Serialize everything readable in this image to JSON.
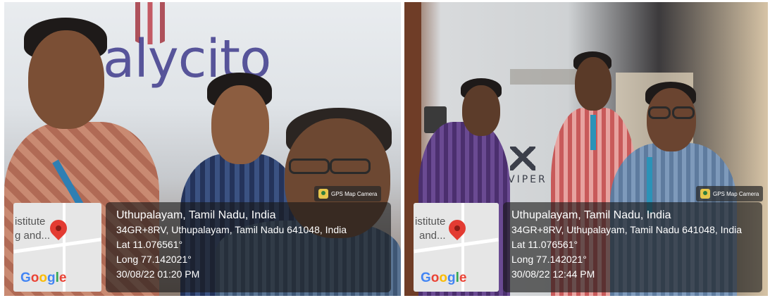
{
  "photos": [
    {
      "id": "left",
      "logo_text": "alycito",
      "badge": "GPS Map Camera",
      "map_text_1": "istitute",
      "map_text_2": "g and...",
      "google": [
        "G",
        "o",
        "o",
        "g",
        "l",
        "e"
      ],
      "location_title": "Uthupalayam, Tamil Nadu, India",
      "address": "34GR+8RV, Uthupalayam, Tamil Nadu 641048, India",
      "lat": "Lat 11.076561°",
      "long": "Long 77.142021°",
      "datetime": "30/08/22 01:20 PM"
    },
    {
      "id": "right",
      "sign_text": "VIPER",
      "badge": "GPS Map Camera",
      "map_text_1": "istitute",
      "map_text_2": "and...",
      "google": [
        "G",
        "o",
        "o",
        "g",
        "l",
        "e"
      ],
      "location_title": "Uthupalayam, Tamil Nadu, India",
      "address": "34GR+8RV, Uthupalayam, Tamil Nadu 641048, India",
      "lat": "Lat 11.076561°",
      "long": "Long 77.142021°",
      "datetime": "30/08/22 12:44 PM"
    }
  ]
}
